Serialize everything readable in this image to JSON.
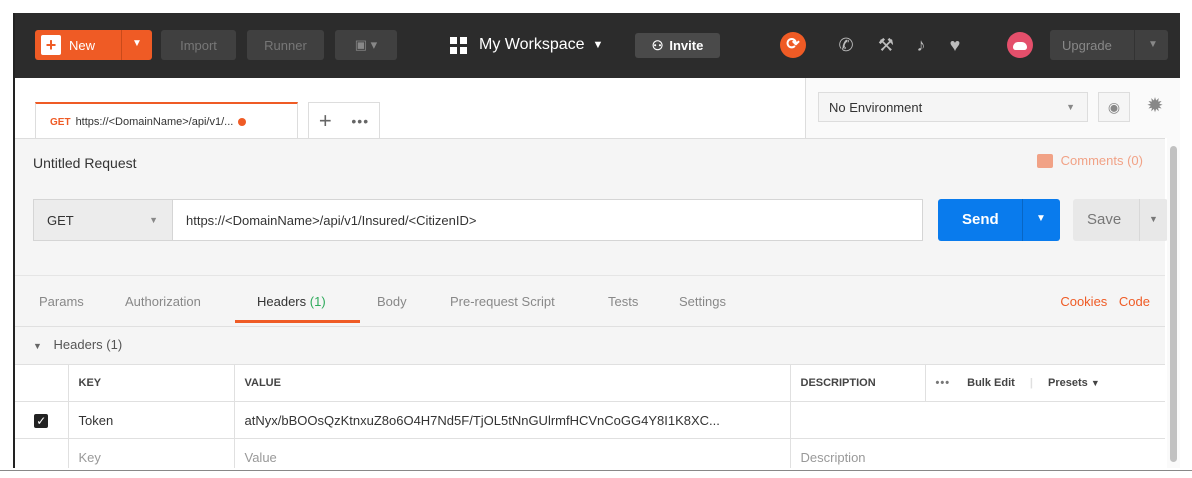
{
  "topbar": {
    "new_label": "New",
    "import_label": "Import",
    "runner_label": "Runner",
    "workspace_label": "My Workspace",
    "invite_label": "Invite",
    "upgrade_label": "Upgrade",
    "accent_color": "#ef5b25",
    "icons": [
      "new-plus-icon",
      "launch-icon",
      "workspace-grid-icon",
      "invite-user-icon",
      "sync-icon",
      "satellite-icon",
      "wrench-icon",
      "bell-icon",
      "heart-icon",
      "cloud-avatar-icon"
    ]
  },
  "tabs": {
    "active_method": "GET",
    "active_url": "https://<DomainName>/api/v1/...",
    "new_tab": "+",
    "more": "•••"
  },
  "environment": {
    "selected": "No Environment"
  },
  "request": {
    "title": "Untitled Request",
    "comments": "Comments (0)",
    "method": "GET",
    "url": "https://<DomainName>/api/v1/Insured/<CitizenID>",
    "send_label": "Send",
    "save_label": "Save",
    "send_color": "#097bed"
  },
  "subtabs": {
    "params": "Params",
    "authorization": "Authorization",
    "headers": "Headers",
    "headers_count": "(1)",
    "body": "Body",
    "prerequest": "Pre-request Script",
    "tests": "Tests",
    "settings": "Settings",
    "cookies": "Cookies",
    "code": "Code"
  },
  "headers": {
    "section_title": "Headers (1)",
    "columns": {
      "key": "KEY",
      "value": "VALUE",
      "description": "DESCRIPTION"
    },
    "more": "•••",
    "bulk_edit": "Bulk Edit",
    "presets": "Presets",
    "rows": [
      {
        "checked": true,
        "key": "Token",
        "value": "atNyx/bBOOsQzKtnxuZ8o6O4H7Nd5F/TjOL5tNnGUlrmfHCVnCoGG4Y8I1K8XC...",
        "description": ""
      }
    ],
    "placeholders": {
      "key": "Key",
      "value": "Value",
      "description": "Description"
    }
  }
}
